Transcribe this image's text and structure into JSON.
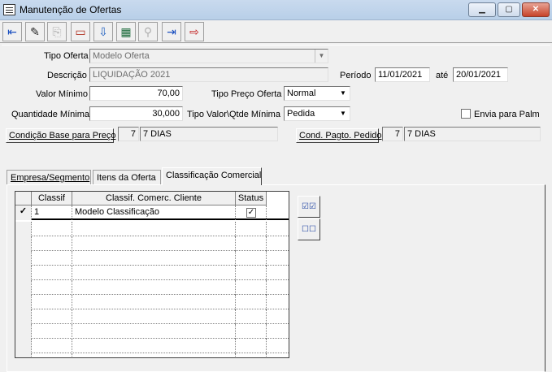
{
  "window": {
    "title": "Manutenção de Ofertas"
  },
  "form": {
    "tipo_oferta_label": "Tipo Oferta",
    "tipo_oferta_value": "Modelo Oferta",
    "descricao_label": "Descrição",
    "descricao_value": "LIQUIDAÇÃO 2021",
    "periodo_label": "Período",
    "periodo_inicio": "11/01/2021",
    "ate_label": "até",
    "periodo_fim": "20/01/2021",
    "valor_minimo_label": "Valor Mínimo",
    "valor_minimo_value": "70,00",
    "tipo_preco_label": "Tipo Preço Oferta",
    "tipo_preco_value": "Normal",
    "qtd_minima_label": "Quantidade Mínima",
    "qtd_minima_value": "30,000",
    "tipo_valor_label": "Tipo Valor\\Qtde Mínima",
    "tipo_valor_value": "Pedida",
    "envia_palm_label": "Envia para Palm",
    "cond_base_button": "Condição Base para Preço",
    "cond_base_code": "7",
    "cond_base_desc": "7 DIAS",
    "cond_pagto_button": "Cond. Pagto. Pedido",
    "cond_pagto_code": "7",
    "cond_pagto_desc": "7 DIAS"
  },
  "tabs": [
    "Empresa/Segmento",
    "Itens da Oferta",
    "Classificação Comercial"
  ],
  "grid": {
    "headers": [
      "Classif",
      "Classif. Comerc. Cliente",
      "Status"
    ],
    "rows": [
      {
        "classif": "1",
        "cliente": "Modelo Classificação",
        "status": true
      }
    ]
  },
  "icons": [
    "exit-icon",
    "edit-icon",
    "paste-icon",
    "open-folder-icon",
    "import-icon",
    "calculator-icon",
    "lookup-icon",
    "insert-icon",
    "export-icon"
  ]
}
